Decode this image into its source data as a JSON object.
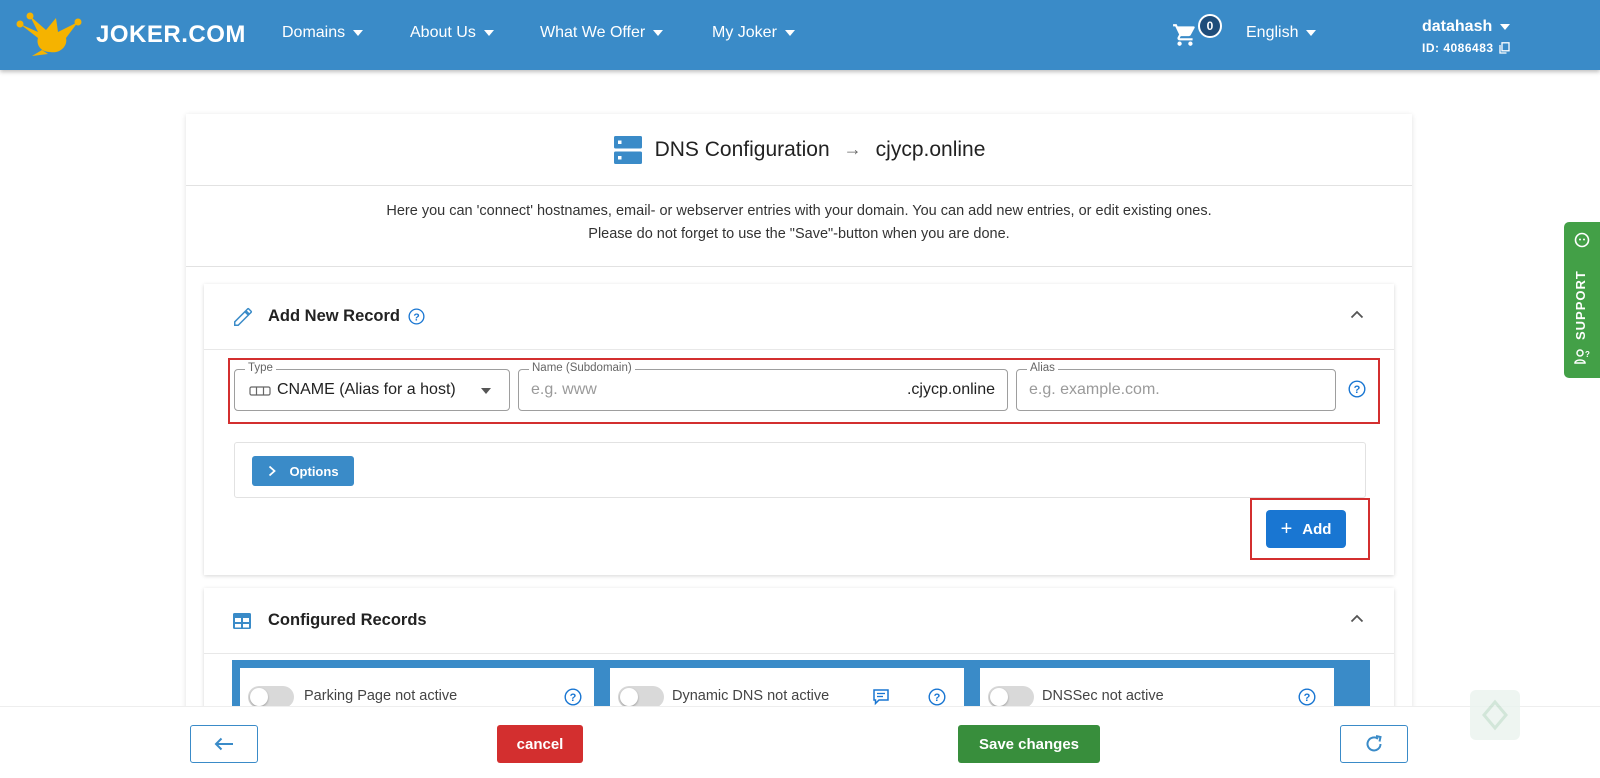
{
  "nav": {
    "brand": "JOKER.COM",
    "items": [
      {
        "label": "Domains"
      },
      {
        "label": "About Us"
      },
      {
        "label": "What We Offer"
      },
      {
        "label": "My Joker"
      }
    ],
    "cart_count": "0",
    "language": "English",
    "user_name": "datahash",
    "user_id": "ID: 4086483"
  },
  "page": {
    "title": "DNS Configuration",
    "domain": "cjycp.online",
    "intro_line1": "Here you can 'connect' hostnames, email- or webserver entries with your domain. You can add new entries, or edit existing ones.",
    "intro_line2": "Please do not forget to use the \"Save\"-button when you are done."
  },
  "add_record": {
    "heading": "Add New Record",
    "type_label": "Type",
    "type_value": "CNAME (Alias for a host)",
    "name_label": "Name (Subdomain)",
    "name_placeholder": "e.g. www",
    "name_suffix": ".cjycp.online",
    "alias_label": "Alias",
    "alias_placeholder": "e.g. example.com.",
    "options_label": "Options",
    "add_label": "Add"
  },
  "configured": {
    "heading": "Configured Records",
    "parking": "Parking Page not active",
    "dyndns": "Dynamic DNS not active",
    "dnssec": "DNSSec not active"
  },
  "footer": {
    "cancel_label": "cancel",
    "save_label": "Save changes"
  },
  "support": {
    "label": "SUPPORT"
  },
  "colors": {
    "nav": "#3a8bc8",
    "primary": "#1976d2",
    "cancel": "#d32f2f",
    "save": "#388e3c",
    "support": "#43a047",
    "highlight": "#d32f2f"
  }
}
